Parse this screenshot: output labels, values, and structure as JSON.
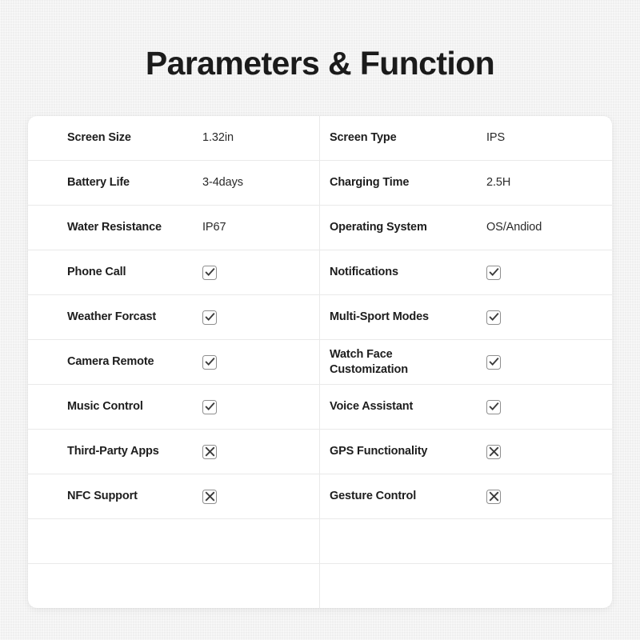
{
  "page": {
    "title": "Parameters & Function",
    "background_color": "#f1f1f1",
    "card_background": "#ffffff",
    "text_color": "#1d1d1d",
    "divider_color": "#e9e9e9",
    "mark_border_color": "#8e8e8e",
    "mark_glyph_color": "#3b3b3b"
  },
  "table": {
    "column_count": 2,
    "row_count": 11,
    "rows": [
      {
        "left": {
          "label": "Screen Size",
          "type": "text",
          "value": "1.32in"
        },
        "right": {
          "label": "Screen Type",
          "type": "text",
          "value": "IPS"
        }
      },
      {
        "left": {
          "label": "Battery Life",
          "type": "text",
          "value": "3-4days"
        },
        "right": {
          "label": "Charging Time",
          "type": "text",
          "value": "2.5H"
        }
      },
      {
        "left": {
          "label": "Water Resistance",
          "type": "text",
          "value": "IP67"
        },
        "right": {
          "label": "Operating System",
          "type": "text",
          "value": "OS/Andiod"
        }
      },
      {
        "left": {
          "label": "Phone Call",
          "type": "mark",
          "value": "check"
        },
        "right": {
          "label": "Notifications",
          "type": "mark",
          "value": "check"
        }
      },
      {
        "left": {
          "label": "Weather Forcast",
          "type": "mark",
          "value": "check"
        },
        "right": {
          "label": "Multi-Sport Modes",
          "type": "mark",
          "value": "check"
        }
      },
      {
        "left": {
          "label": "Camera Remote",
          "type": "mark",
          "value": "check"
        },
        "right": {
          "label": "Watch Face Customization",
          "type": "mark",
          "value": "check"
        }
      },
      {
        "left": {
          "label": "Music Control",
          "type": "mark",
          "value": "check"
        },
        "right": {
          "label": "Voice Assistant",
          "type": "mark",
          "value": "check"
        }
      },
      {
        "left": {
          "label": "Third-Party Apps",
          "type": "mark",
          "value": "cross"
        },
        "right": {
          "label": "GPS Functionality",
          "type": "mark",
          "value": "cross"
        }
      },
      {
        "left": {
          "label": "NFC Support",
          "type": "mark",
          "value": "cross"
        },
        "right": {
          "label": "Gesture Control",
          "type": "mark",
          "value": "cross"
        }
      },
      {
        "left": {
          "label": "",
          "type": "empty",
          "value": ""
        },
        "right": {
          "label": "",
          "type": "empty",
          "value": ""
        }
      },
      {
        "left": {
          "label": "",
          "type": "empty",
          "value": ""
        },
        "right": {
          "label": "",
          "type": "empty",
          "value": ""
        }
      }
    ]
  }
}
